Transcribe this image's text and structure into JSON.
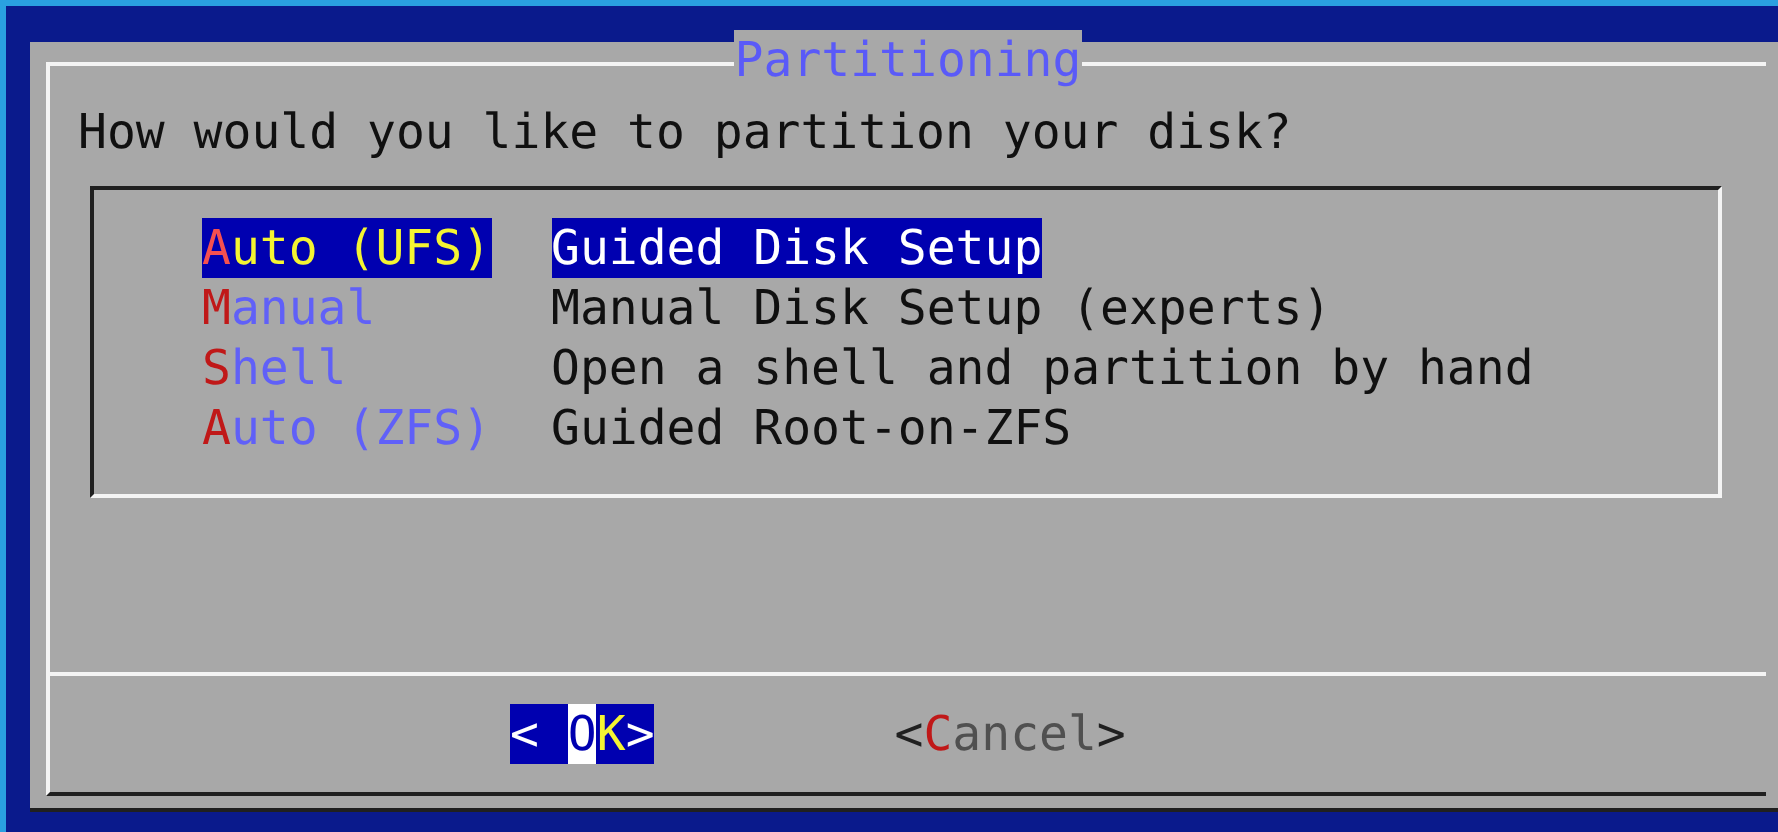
{
  "dialog": {
    "title": "Partitioning",
    "prompt": "How would you like to partition your disk?",
    "items": [
      {
        "tag": "Auto (UFS)",
        "description": "Guided Disk Setup",
        "selected": true
      },
      {
        "tag": "Manual",
        "description": "Manual Disk Setup (experts)",
        "selected": false
      },
      {
        "tag": "Shell",
        "description": "Open a shell and partition by hand",
        "selected": false
      },
      {
        "tag": "Auto (ZFS)",
        "description": "Guided Root-on-ZFS",
        "selected": false
      }
    ],
    "buttons": [
      {
        "open": "<",
        "label": "OK",
        "close": ">",
        "selected": true
      },
      {
        "open": "<",
        "label": "Cancel",
        "close": ">",
        "selected": false
      }
    ]
  }
}
